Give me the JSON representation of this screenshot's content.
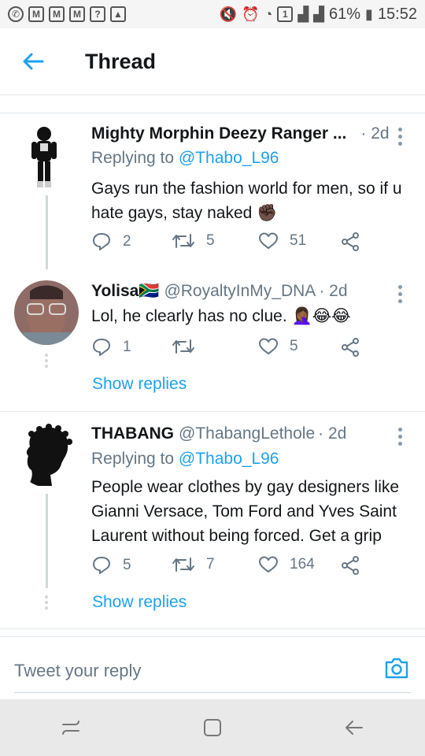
{
  "status_bar": {
    "battery": "61%",
    "time": "15:52",
    "sim_badge": "1"
  },
  "header": {
    "title": "Thread"
  },
  "tweets": [
    {
      "name": "Mighty Morphin Deezy Ranger ...",
      "handle": "",
      "time": "· 2d",
      "replying_prefix": "Replying to ",
      "replying_to": "@Thabo_L96",
      "text": "Gays run the fashion world for men, so if u hate gays, stay naked ✊🏿",
      "replies": "2",
      "retweets": "5",
      "likes": "51",
      "show_replies": ""
    },
    {
      "name": "Yolisa🇿🇦",
      "handle": "@RoyaltyInMy_DNA",
      "time": "· 2d",
      "replying_prefix": "",
      "replying_to": "",
      "text": "Lol, he clearly has no clue. 🤦🏾‍♀️😂😂",
      "replies": "1",
      "retweets": "",
      "likes": "5",
      "show_replies": "Show replies"
    },
    {
      "name": "THABANG",
      "handle": "@ThabangLethole",
      "time": "· 2d",
      "replying_prefix": "Replying to ",
      "replying_to": "@Thabo_L96",
      "text": "People wear clothes by gay designers like Gianni Versace, Tom Ford and  Yves Saint Laurent without being forced. Get a grip",
      "replies": "5",
      "retweets": "7",
      "likes": "164",
      "show_replies": "Show replies"
    }
  ],
  "composer": {
    "placeholder": "Tweet your reply"
  },
  "colors": {
    "accent": "#1da1f2",
    "muted": "#657786",
    "text": "#14171a",
    "divider": "#e1e8ed"
  },
  "icons": {
    "back": "arrow-left-icon",
    "reply": "reply-icon",
    "retweet": "retweet-icon",
    "like": "heart-icon",
    "share": "share-icon",
    "camera": "camera-icon"
  }
}
